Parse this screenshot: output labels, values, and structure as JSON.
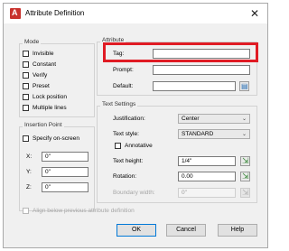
{
  "window": {
    "title": "Attribute Definition",
    "close_glyph": "✕"
  },
  "mode": {
    "label": "Mode",
    "items": [
      {
        "label": "Invisible"
      },
      {
        "label": "Constant"
      },
      {
        "label": "Verify"
      },
      {
        "label": "Preset"
      },
      {
        "label": "Lock position"
      },
      {
        "label": "Multiple lines"
      }
    ]
  },
  "attribute": {
    "label": "Attribute",
    "tag_label": "Tag:",
    "tag_value": "",
    "prompt_label": "Prompt:",
    "prompt_value": "",
    "default_label": "Default:",
    "default_value": "",
    "insert_field_icon": "insert-field-icon"
  },
  "insertion_point": {
    "label": "Insertion Point",
    "specify_label": "Specify on-screen",
    "x_label": "X:",
    "x_value": "0\"",
    "y_label": "Y:",
    "y_value": "0\"",
    "z_label": "Z:",
    "z_value": "0\""
  },
  "text_settings": {
    "label": "Text Settings",
    "justification_label": "Justification:",
    "justification_value": "Center",
    "text_style_label": "Text style:",
    "text_style_value": "STANDARD",
    "annotative_label": "Annotative",
    "text_height_label": "Text height:",
    "text_height_value": "1/4\"",
    "rotation_label": "Rotation:",
    "rotation_value": "0.00",
    "boundary_width_label": "Boundary width:",
    "boundary_width_value": "0\""
  },
  "align_below_label": "Align below previous attribute definition",
  "buttons": {
    "ok": "OK",
    "cancel": "Cancel",
    "help": "Help"
  },
  "colors": {
    "highlight": "#e01b24",
    "default_button_border": "#0078d7"
  }
}
